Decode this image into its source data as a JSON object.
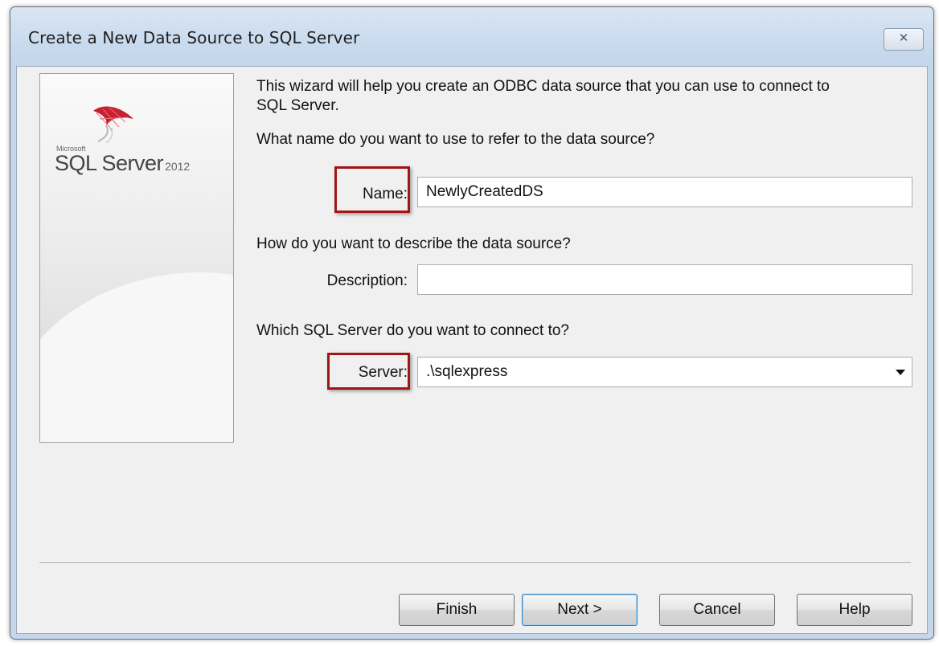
{
  "window": {
    "title": "Create a New Data Source to SQL Server",
    "close_label": "✕"
  },
  "logo": {
    "vendor": "Microsoft",
    "product": "SQL Server",
    "version": "2012"
  },
  "wizard": {
    "intro": "This wizard will help you create an ODBC data source that you can use to connect to",
    "intro_line2": "SQL Server.",
    "name_question": "What name do you want to use to refer to the data source?",
    "name_label": "Name:",
    "name_value": "NewlyCreatedDS",
    "description_question": "How do you want to describe the data source?",
    "description_label": "Description:",
    "description_value": "",
    "server_question": "Which SQL Server do you want to connect to?",
    "server_label": "Server:",
    "server_value": ".\\sqlexpress"
  },
  "buttons": {
    "finish": "Finish",
    "next": "Next >",
    "cancel": "Cancel",
    "help": "Help"
  },
  "colors": {
    "highlight_box": "#a31515",
    "title_bar": "#c4d7ec",
    "dialog_face": "#f0f0f0",
    "logo_red": "#c8202f"
  },
  "icons": {
    "close": "close-icon",
    "logo": "sql-server-logo-icon",
    "dropdown": "chevron-down-icon"
  }
}
